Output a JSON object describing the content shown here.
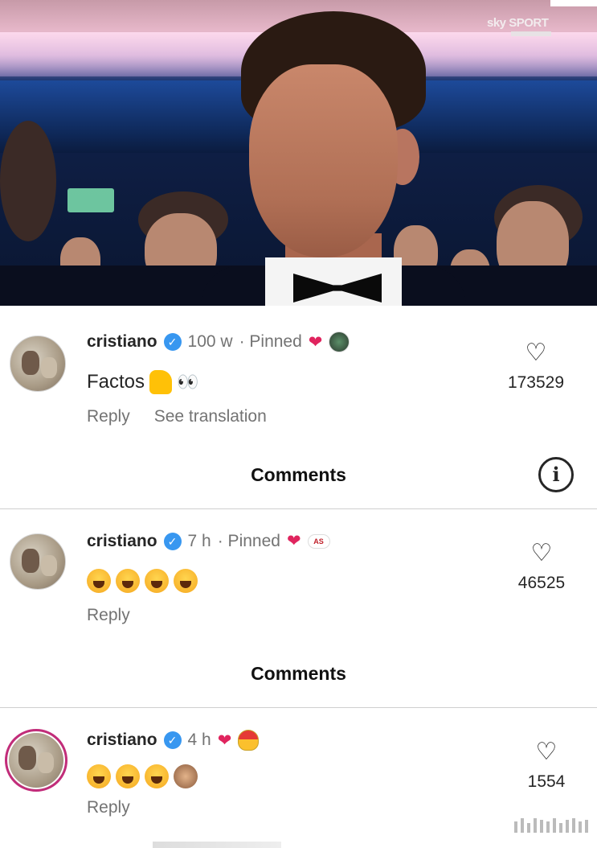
{
  "photo": {
    "broadcaster": "sky SPORT"
  },
  "comments": [
    {
      "username": "cristiano",
      "time": "100 w",
      "pinned": "· Pinned",
      "text": "Factos",
      "emojis": [
        "thumbs-up",
        "eyes"
      ],
      "reply": "Reply",
      "translate": "See translation",
      "likes": "173529"
    },
    {
      "username": "cristiano",
      "time": "7 h",
      "pinned": "· Pinned",
      "badge": "AS",
      "emojis": [
        "laughing-tears",
        "laughing-tears",
        "laughing-tears",
        "laughing-tears"
      ],
      "reply": "Reply",
      "likes": "46525"
    },
    {
      "username": "cristiano",
      "time": "4 h",
      "emojis": [
        "laughing-tears",
        "laughing-tears",
        "laughing-tears",
        "see-no-evil-monkey"
      ],
      "reply": "Reply",
      "likes": "1554"
    }
  ],
  "sections": {
    "comments_title_1": "Comments",
    "comments_title_2": "Comments"
  },
  "icons": {
    "verified": "verified-badge-icon",
    "heart": "heart-outline-icon",
    "info": "info-icon"
  },
  "colors": {
    "verified_blue": "#3897f0",
    "heart_red": "#e0245e",
    "meta_gray": "#737373",
    "story_ring": "#c22c7a"
  }
}
